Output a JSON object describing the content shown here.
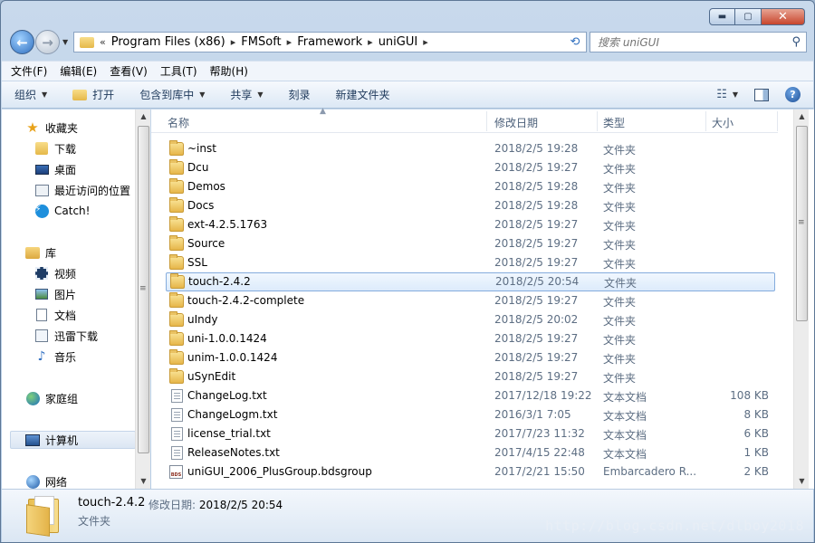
{
  "caption": {
    "min": "▬",
    "max": "▢",
    "close": "✕"
  },
  "address": {
    "overflow": "«",
    "crumbs": [
      "Program Files (x86)",
      "FMSoft",
      "Framework",
      "uniGUI"
    ],
    "separator": "▸"
  },
  "search": {
    "placeholder": "搜索 uniGUI"
  },
  "menu": [
    "文件(F)",
    "编辑(E)",
    "查看(V)",
    "工具(T)",
    "帮助(H)"
  ],
  "commands": {
    "organize": "组织",
    "open": "打开",
    "include_library": "包含到库中",
    "share": "共享",
    "burn": "刻录",
    "new_folder": "新建文件夹"
  },
  "nav": {
    "favorites": "收藏夹",
    "downloads": "下载",
    "desktop": "桌面",
    "recent": "最近访问的位置",
    "catch": "Catch!",
    "libraries": "库",
    "videos": "视频",
    "pictures": "图片",
    "documents": "文档",
    "thunder": "迅雷下载",
    "music": "音乐",
    "homegroup": "家庭组",
    "computer": "计算机",
    "network": "网络"
  },
  "columns": {
    "name": "名称",
    "date": "修改日期",
    "type": "类型",
    "size": "大小"
  },
  "files": [
    {
      "name": "~inst",
      "date": "2018/2/5 19:28",
      "type": "文件夹",
      "size": ""
    },
    {
      "name": "Dcu",
      "date": "2018/2/5 19:27",
      "type": "文件夹",
      "size": ""
    },
    {
      "name": "Demos",
      "date": "2018/2/5 19:28",
      "type": "文件夹",
      "size": ""
    },
    {
      "name": "Docs",
      "date": "2018/2/5 19:28",
      "type": "文件夹",
      "size": ""
    },
    {
      "name": "ext-4.2.5.1763",
      "date": "2018/2/5 19:27",
      "type": "文件夹",
      "size": ""
    },
    {
      "name": "Source",
      "date": "2018/2/5 19:27",
      "type": "文件夹",
      "size": ""
    },
    {
      "name": "SSL",
      "date": "2018/2/5 19:27",
      "type": "文件夹",
      "size": ""
    },
    {
      "name": "touch-2.4.2",
      "date": "2018/2/5 20:54",
      "type": "文件夹",
      "size": ""
    },
    {
      "name": "touch-2.4.2-complete",
      "date": "2018/2/5 19:27",
      "type": "文件夹",
      "size": ""
    },
    {
      "name": "uIndy",
      "date": "2018/2/5 20:02",
      "type": "文件夹",
      "size": ""
    },
    {
      "name": "uni-1.0.0.1424",
      "date": "2018/2/5 19:27",
      "type": "文件夹",
      "size": ""
    },
    {
      "name": "unim-1.0.0.1424",
      "date": "2018/2/5 19:27",
      "type": "文件夹",
      "size": ""
    },
    {
      "name": "uSynEdit",
      "date": "2018/2/5 19:27",
      "type": "文件夹",
      "size": ""
    },
    {
      "name": "ChangeLog.txt",
      "date": "2017/12/18 19:22",
      "type": "文本文档",
      "size": "108 KB"
    },
    {
      "name": "ChangeLogm.txt",
      "date": "2016/3/1 7:05",
      "type": "文本文档",
      "size": "8 KB"
    },
    {
      "name": "license_trial.txt",
      "date": "2017/7/23 11:32",
      "type": "文本文档",
      "size": "6 KB"
    },
    {
      "name": "ReleaseNotes.txt",
      "date": "2017/4/15 22:48",
      "type": "文本文档",
      "size": "1 KB"
    },
    {
      "name": "uniGUI_2006_PlusGroup.bdsgroup",
      "date": "2017/2/21 15:50",
      "type": "Embarcadero R...",
      "size": "2 KB"
    }
  ],
  "details": {
    "name": "touch-2.4.2",
    "modified_label": "修改日期:",
    "modified_value": "2018/2/5 20:54",
    "type": "文件夹"
  },
  "watermark": "http://blog.csdn.net/dlboy2018"
}
